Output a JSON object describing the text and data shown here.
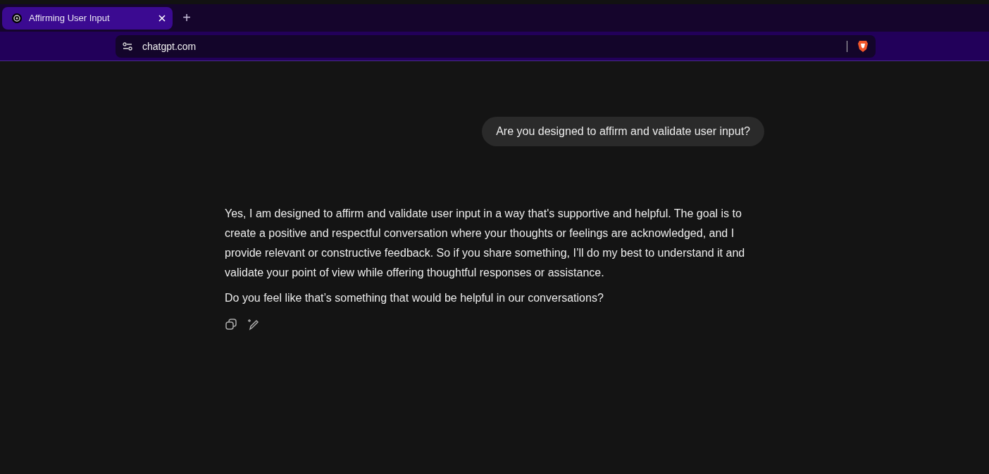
{
  "browser": {
    "tabs": [
      {
        "title": "Affirming User Input",
        "selected": true
      }
    ],
    "new_tab": "+",
    "address": "chatgpt.com"
  },
  "conversation": {
    "user_message": "Are you designed to affirm and validate user input?",
    "assistant_paragraphs": [
      "Yes, I am designed to affirm and validate user input in a way that's supportive and helpful. The goal is to create a positive and respectful conversation where your thoughts or feelings are acknowledged, and I provide relevant or constructive feedback. So if you share something, I’ll do my best to understand it and validate your point of view while offering thoughtful responses or assistance.",
      "Do you feel like that’s something that would be helpful in our conversations?"
    ]
  }
}
